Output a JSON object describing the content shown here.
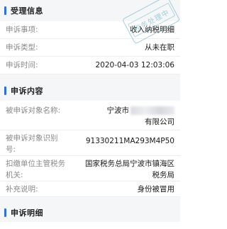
{
  "sections": {
    "handling": {
      "title": "受理信息"
    },
    "content": {
      "title": "申诉内容"
    },
    "detail": {
      "title": "申诉明细"
    }
  },
  "handling_rows": {
    "item": {
      "label": "申诉事项:",
      "value": "收入纳税明细"
    },
    "type": {
      "label": "申诉类型:",
      "value": "从未在职"
    },
    "time": {
      "label": "申诉时间:",
      "value": "2020-04-03 12:03:06"
    }
  },
  "content_rows": {
    "target_name": {
      "label": "被申诉对象名称:",
      "value_prefix": "宁波市",
      "value_suffix": "有限公司"
    },
    "target_id": {
      "label_line1": "被申诉对象识别",
      "label_line2": "号:",
      "value": "91330211MA293M4P50"
    },
    "tax_authority": {
      "label_line1": "扣缴单位主管税务",
      "label_line2": "机关:",
      "value_line1": "国家税务总局宁波市镇海区",
      "value_line2": "税务局"
    },
    "remark": {
      "label": "补充说明:",
      "value": "身份被冒用"
    }
  },
  "stamp": {
    "text": "税务处理中"
  },
  "colors": {
    "accent": "#2f6fe0",
    "section_bg": "#f5f6f8",
    "stamp": "#5aaabe"
  }
}
